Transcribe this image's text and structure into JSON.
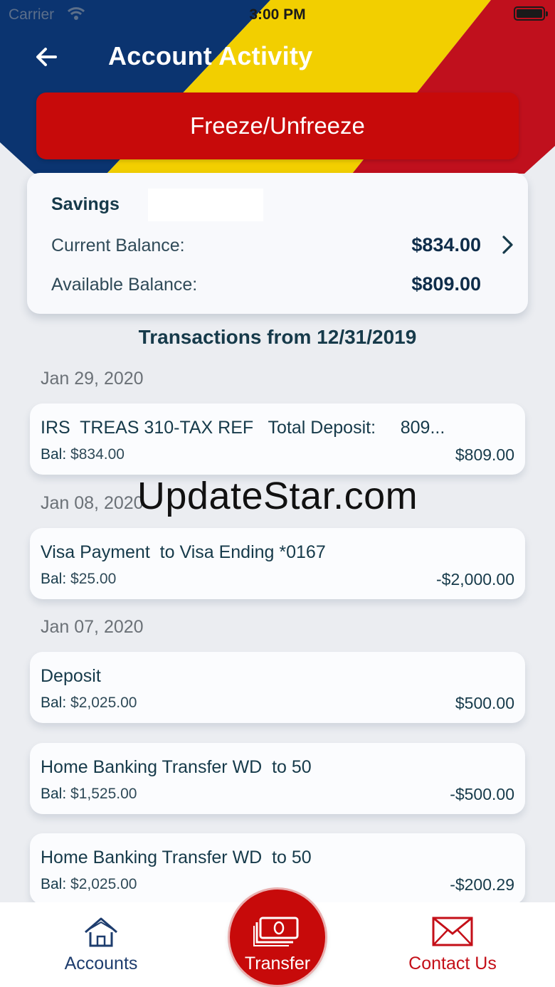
{
  "status_bar": {
    "carrier": "Carrier",
    "time": "3:00 PM"
  },
  "header": {
    "title": "Account Activity",
    "back_icon": "back-arrow-icon",
    "freeze_button_label": "Freeze/Unfreeze",
    "colors": {
      "navy": "#0b3470",
      "yellow": "#f2cf00",
      "red": "#c0101d",
      "button_red": "#c70a0a"
    }
  },
  "account": {
    "name": "Savings",
    "current_balance_label": "Current Balance:",
    "current_balance": "$834.00",
    "available_balance_label": "Available Balance:",
    "available_balance": "$809.00"
  },
  "transactions_header": "Transactions from 12/31/2019",
  "groups": [
    {
      "date": "Jan 29, 2020",
      "items": [
        {
          "description": "IRS  TREAS 310-TAX REF   Total Deposit:     809...",
          "bal_label": "Bal:",
          "balance": "$834.00",
          "amount": "$809.00"
        }
      ]
    },
    {
      "date": "Jan 08, 2020",
      "items": [
        {
          "description": "Visa Payment  to Visa Ending *0167",
          "bal_label": "Bal:",
          "balance": "$25.00",
          "amount": "-$2,000.00"
        }
      ]
    },
    {
      "date": "Jan 07, 2020",
      "items": [
        {
          "description": "Deposit",
          "bal_label": "Bal:",
          "balance": "$2,025.00",
          "amount": "$500.00"
        },
        {
          "description": "Home Banking Transfer WD  to 50",
          "bal_label": "Bal:",
          "balance": "$1,525.00",
          "amount": "-$500.00"
        },
        {
          "description": "Home Banking Transfer WD  to 50",
          "bal_label": "Bal:",
          "balance": "$2,025.00",
          "amount": "-$200.29"
        }
      ]
    }
  ],
  "watermark": "UpdateStar.com",
  "tabbar": {
    "accounts_label": "Accounts",
    "transfer_label": "Transfer",
    "contact_label": "Contact Us",
    "accounts_icon": "home-icon",
    "transfer_icon": "money-icon",
    "contact_icon": "mail-icon"
  }
}
